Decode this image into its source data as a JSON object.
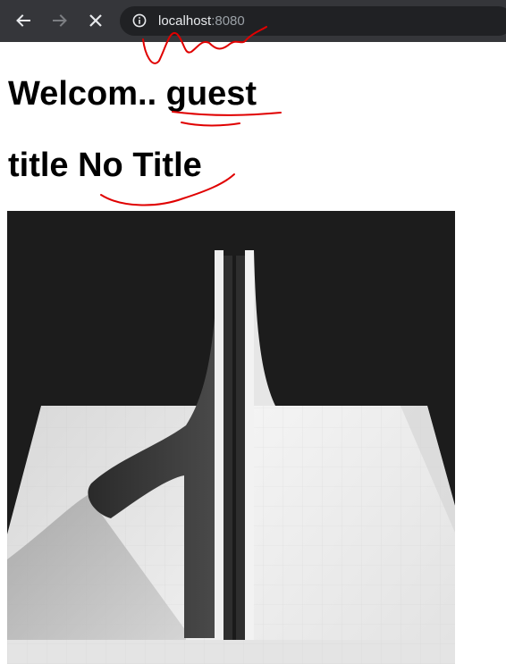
{
  "browser": {
    "back_icon": "arrow-left-icon",
    "forward_icon": "arrow-right-icon",
    "stop_icon": "close-icon",
    "info_icon": "info-icon",
    "url_host": "localhost",
    "url_port": ":8080"
  },
  "page": {
    "welcome_heading": "Welcom.. guest",
    "title_heading": "title No Title"
  },
  "colors": {
    "chrome_bg": "#35363a",
    "address_bg": "#202124",
    "annotation": "#e00000"
  }
}
